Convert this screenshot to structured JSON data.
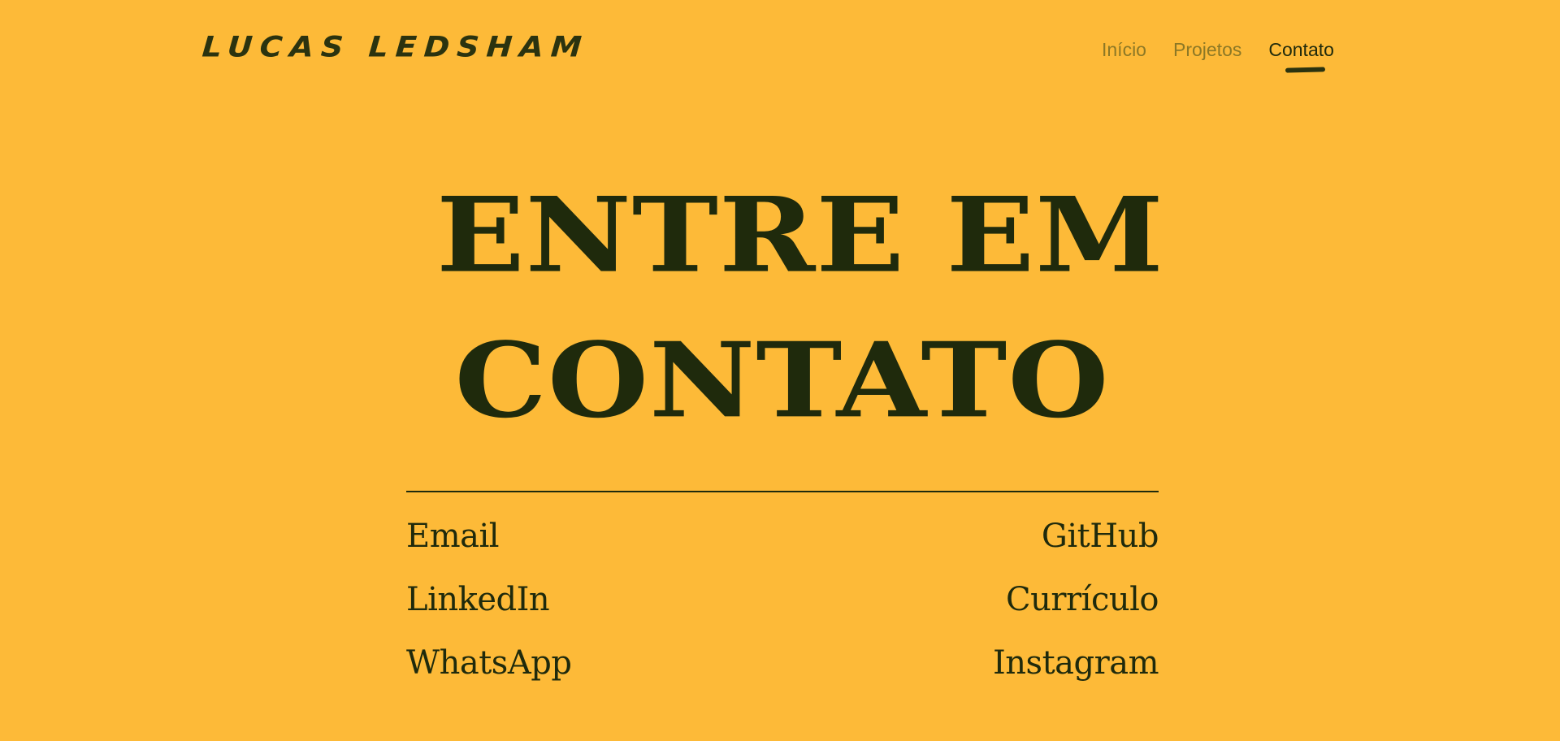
{
  "header": {
    "logo_text": "LUCAS LEDSHAM",
    "nav": [
      {
        "label": "Início",
        "active": false
      },
      {
        "label": "Projetos",
        "active": false
      },
      {
        "label": "Contato",
        "active": true
      }
    ]
  },
  "hero": {
    "line1": "ENTRE EM",
    "line2": "CONTATO"
  },
  "contacts": {
    "left": [
      "Email",
      "LinkedIn",
      "WhatsApp"
    ],
    "right": [
      "GitHub",
      "Currículo",
      "Instagram"
    ]
  },
  "colors": {
    "background": "#FDBA38",
    "text": "#1F2A0C",
    "nav_inactive": "#8C7826"
  }
}
